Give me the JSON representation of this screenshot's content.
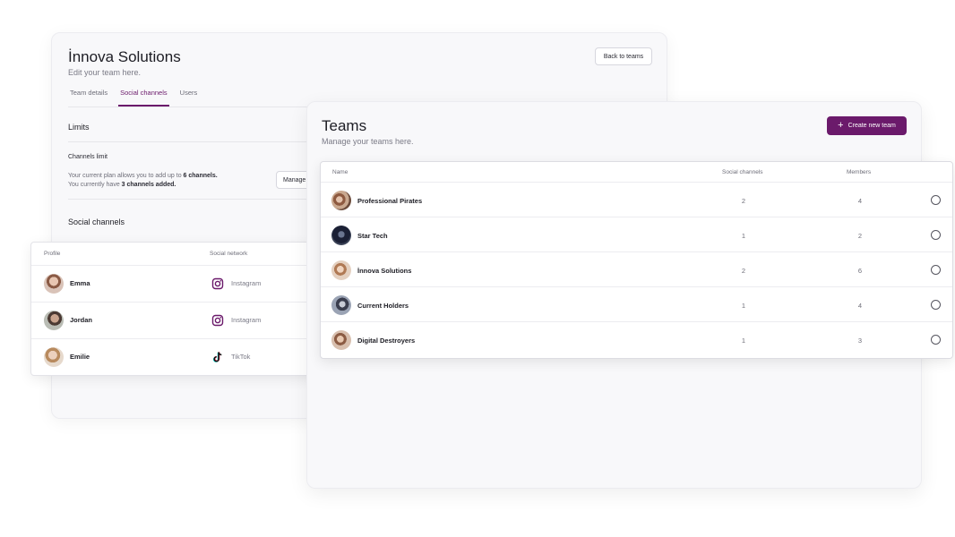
{
  "team_edit": {
    "title": "İnnova Solutions",
    "subtitle": "Edit your team here.",
    "back_button": "Back to teams",
    "tabs": [
      {
        "label": "Team details"
      },
      {
        "label": "Social channels"
      },
      {
        "label": "Users"
      }
    ],
    "active_tab": "Social channels",
    "limits_heading": "Limits",
    "channels_limit_label": "Channels limit",
    "plan_prefix": "Your current plan allows you to add up to ",
    "plan_limit": "6 channels.",
    "current_prefix": "You currently have ",
    "current_count": "3 channels added.",
    "manage_button": "Manage",
    "social_heading": "Social channels",
    "profiles_table": {
      "columns": {
        "profile": "Profile",
        "network": "Social network"
      },
      "rows": [
        {
          "name": "Emma",
          "network": "Instagram",
          "icon": "instagram-icon"
        },
        {
          "name": "Jordan",
          "network": "Instagram",
          "icon": "instagram-icon"
        },
        {
          "name": "Emilie",
          "network": "TikTok",
          "icon": "tiktok-icon"
        }
      ]
    }
  },
  "teams": {
    "title": "Teams",
    "subtitle": "Manage your teams here.",
    "create_button": "Create new team",
    "accent_color": "#6b1a6b",
    "columns": {
      "name": "Name",
      "channels": "Social channels",
      "members": "Members"
    },
    "rows": [
      {
        "name": "Professional Pirates",
        "channels": "2",
        "members": "4"
      },
      {
        "name": "Star Tech",
        "channels": "1",
        "members": "2"
      },
      {
        "name": "İnnova Solutions",
        "channels": "2",
        "members": "6"
      },
      {
        "name": "Current Holders",
        "channels": "1",
        "members": "4"
      },
      {
        "name": "Digital Destroyers",
        "channels": "1",
        "members": "3"
      }
    ]
  }
}
